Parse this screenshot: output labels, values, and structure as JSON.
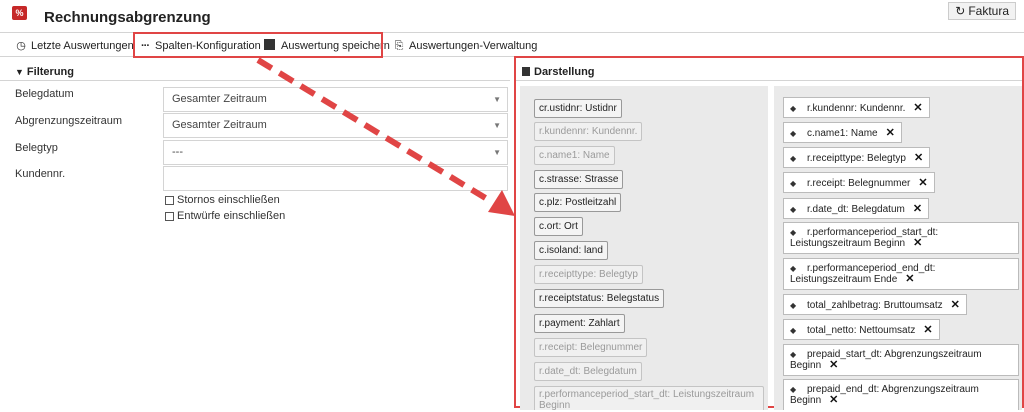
{
  "app": {
    "title": "Rechnungsabgrenzung",
    "logo_text": "%",
    "faktura_label": "Faktura"
  },
  "toolbar": {
    "recent_label": "Letzte Auswertungen",
    "columns_label": "Spalten-Konfiguration",
    "save_label": "Auswertung speichern",
    "manage_label": "Auswertungen-Verwaltung"
  },
  "filter": {
    "title": "Filterung",
    "fields": {
      "belegdatum": {
        "label": "Belegdatum",
        "value": "Gesamter Zeitraum"
      },
      "abgrenzungszeitraum": {
        "label": "Abgrenzungszeitraum",
        "value": "Gesamter Zeitraum"
      },
      "belegtyp": {
        "label": "Belegtyp",
        "value": "---"
      },
      "kundennr": {
        "label": "Kundennr.",
        "value": ""
      }
    },
    "checkboxes": {
      "stornos": "Stornos einschließen",
      "entwuerfe": "Entwürfe einschließen"
    }
  },
  "display": {
    "title": "Darstellung",
    "available": [
      {
        "label": "cr.ustidnr: Ustidnr",
        "disabled": false
      },
      {
        "label": "r.kundennr: Kundennr.",
        "disabled": true
      },
      {
        "label": "c.name1: Name",
        "disabled": true
      },
      {
        "label": "c.strasse: Strasse",
        "disabled": false
      },
      {
        "label": "c.plz: Postleitzahl",
        "disabled": false
      },
      {
        "label": "c.ort: Ort",
        "disabled": false
      },
      {
        "label": "c.isoland: land",
        "disabled": false
      },
      {
        "label": "r.receipttype: Belegtyp",
        "disabled": true
      },
      {
        "label": "r.receiptstatus: Belegstatus",
        "disabled": false
      },
      {
        "label": "r.payment: Zahlart",
        "disabled": false
      },
      {
        "label": "r.receipt: Belegnummer",
        "disabled": true
      },
      {
        "label": "r.date_dt: Belegdatum",
        "disabled": true
      },
      {
        "label": "r.performanceperiod_start_dt: Leistungszeitraum Beginn",
        "disabled": true
      }
    ],
    "selected": [
      "r.kundennr: Kundennr.",
      "c.name1: Name",
      "r.receipttype: Belegtyp",
      "r.receipt: Belegnummer",
      "r.date_dt: Belegdatum",
      "r.performanceperiod_start_dt: Leistungszeitraum Beginn",
      "r.performanceperiod_end_dt: Leistungszeitraum Ende",
      "total_zahlbetrag: Bruttoumsatz",
      "total_netto: Nettoumsatz",
      "prepaid_start_dt: Abgrenzungszeitraum Beginn",
      "prepaid_end_dt: Abgrenzungszeitraum Beginn"
    ]
  },
  "colors": {
    "highlight": "#e04545",
    "brand": "#c62828"
  }
}
